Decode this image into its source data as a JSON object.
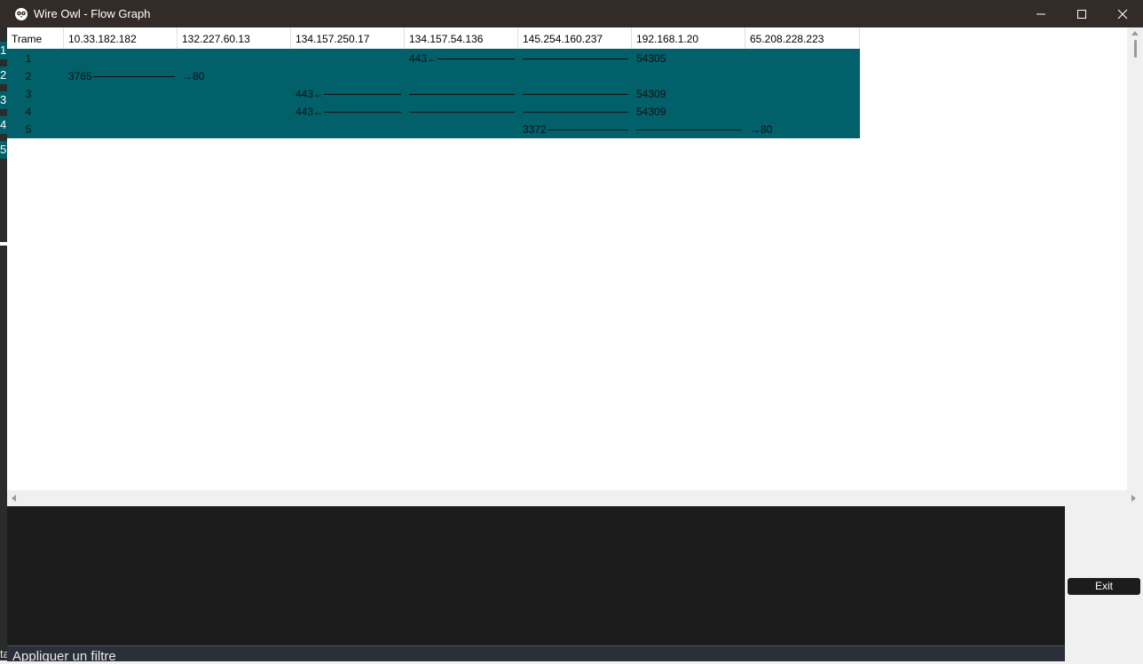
{
  "window": {
    "title": "Wire Owl - Flow Graph",
    "icon": "owl-app-icon",
    "controls": [
      "minimize-icon",
      "maximize-icon",
      "close-icon"
    ]
  },
  "background_window": {
    "strip_items": [
      "4",
      "1",
      "2",
      "3",
      "4",
      "5"
    ],
    "bottom_glyph": "ta"
  },
  "flow_graph": {
    "columns": [
      "Trame",
      "10.33.182.182",
      "132.227.60.13",
      "134.157.250.17",
      "134.157.54.136",
      "145.254.160.237",
      "192.168.1.20",
      "65.208.228.223"
    ],
    "rows": [
      {
        "frame": "1",
        "src_port": "54305",
        "dst_port": "443",
        "arrow": "←",
        "dst_label": "443←"
      },
      {
        "frame": "2",
        "src_port": "3765",
        "dst_port": "80",
        "arrow": "→",
        "dst_label": "→80"
      },
      {
        "frame": "3",
        "src_port": "54309",
        "dst_port": "443",
        "arrow": "←",
        "dst_label": "443←"
      },
      {
        "frame": "4",
        "src_port": "54309",
        "dst_port": "443",
        "arrow": "←",
        "dst_label": "443←"
      },
      {
        "frame": "5",
        "src_port": "3372",
        "dst_port": "80",
        "arrow": "→",
        "dst_label": "→80"
      }
    ],
    "row_color": "#02606a"
  },
  "buttons": {
    "exit_label": "Exit"
  },
  "filter": {
    "placeholder": "Appliquer un filtre"
  },
  "colors": {
    "titlebar": "#332b27",
    "detail_panel": "#1c1c1c",
    "filter_bar": "#2b2f3a"
  }
}
